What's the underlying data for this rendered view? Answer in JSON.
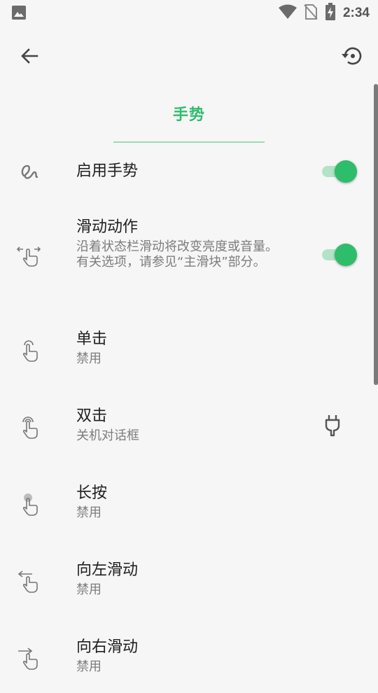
{
  "status_bar": {
    "time": "2:34"
  },
  "header": {
    "title": "手势"
  },
  "colors": {
    "accent": "#2ebd6b",
    "accent_light": "#b3e3c6"
  },
  "settings": [
    {
      "title": "启用手势",
      "icon": "squiggle-gesture-icon",
      "toggle": true
    },
    {
      "title": "滑动动作",
      "subtitle": "沿着状态栏滑动将改变亮度或音量。 有关选项，请参见“主滑块”部分。",
      "icon": "swipe-hand-icon",
      "toggle": true
    },
    {
      "title": "单击",
      "subtitle": "禁用",
      "icon": "tap-hand-icon"
    },
    {
      "title": "双击",
      "subtitle": "关机对话框",
      "icon": "double-tap-hand-icon"
    },
    {
      "title": "长按",
      "subtitle": "禁用",
      "icon": "long-press-hand-icon"
    },
    {
      "title": "向左滑动",
      "subtitle": "禁用",
      "icon": "swipe-left-hand-icon"
    },
    {
      "title": "向右滑动",
      "subtitle": "禁用",
      "icon": "swipe-right-hand-icon"
    }
  ]
}
